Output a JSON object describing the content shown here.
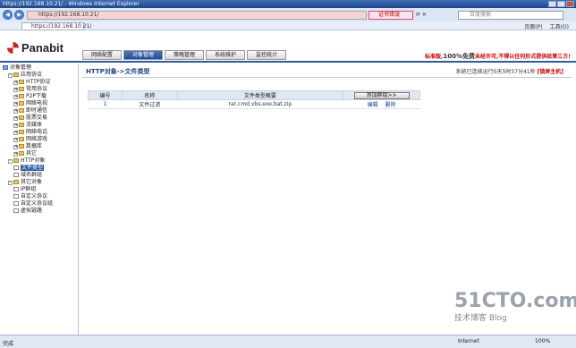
{
  "window": {
    "title": "https://192.168.10.21/ - Windows Internet Explorer"
  },
  "browser": {
    "address": "https://192.168.10.21/",
    "cert_error": "证书错误",
    "search_placeholder": "百度搜索",
    "tab_title": "https://192.168.10.21/",
    "tools": [
      "页面(P)",
      "工具(O)"
    ]
  },
  "app": {
    "logo": "Panabit",
    "nav": [
      "网络配置",
      "对象管理",
      "策略管理",
      "系统维护",
      "监控统计"
    ],
    "active_nav": 1,
    "promo_prefix": "标准版,",
    "promo_big": "100%免费",
    "promo_suffix": "未经许可,不得以任何形式提供给第三方!"
  },
  "sidebar": {
    "items": [
      {
        "label": "对象管理",
        "level": 0,
        "icon": "pc",
        "pm": ""
      },
      {
        "label": "应用协议",
        "level": 1,
        "icon": "folder",
        "pm": "-"
      },
      {
        "label": "HTTP协议",
        "level": 2,
        "icon": "folder",
        "pm": "+"
      },
      {
        "label": "常用协议",
        "level": 2,
        "icon": "folder",
        "pm": "+"
      },
      {
        "label": "P2P下载",
        "level": 2,
        "icon": "folder",
        "pm": "+"
      },
      {
        "label": "网络电视",
        "level": 2,
        "icon": "folder",
        "pm": "+"
      },
      {
        "label": "即时通信",
        "level": 2,
        "icon": "folder",
        "pm": "+"
      },
      {
        "label": "股票交易",
        "level": 2,
        "icon": "folder",
        "pm": "+"
      },
      {
        "label": "流媒体",
        "level": 2,
        "icon": "folder",
        "pm": "+"
      },
      {
        "label": "网络电话",
        "level": 2,
        "icon": "folder",
        "pm": "+"
      },
      {
        "label": "网络游戏",
        "level": 2,
        "icon": "folder",
        "pm": "+"
      },
      {
        "label": "数据库",
        "level": 2,
        "icon": "folder",
        "pm": "+"
      },
      {
        "label": "其它",
        "level": 2,
        "icon": "folder",
        "pm": "+"
      },
      {
        "label": "HTTP对象",
        "level": 1,
        "icon": "folder",
        "pm": "-"
      },
      {
        "label": "文件类型",
        "level": 2,
        "icon": "doc",
        "pm": "",
        "selected": true
      },
      {
        "label": "域名群组",
        "level": 2,
        "icon": "doc",
        "pm": ""
      },
      {
        "label": "其它对象",
        "level": 1,
        "icon": "folder",
        "pm": "-"
      },
      {
        "label": "IP群组",
        "level": 2,
        "icon": "doc",
        "pm": ""
      },
      {
        "label": "自定义协议",
        "level": 2,
        "icon": "doc",
        "pm": ""
      },
      {
        "label": "自定义协议组",
        "level": 2,
        "icon": "doc",
        "pm": ""
      },
      {
        "label": "虚拟链路",
        "level": 2,
        "icon": "doc",
        "pm": ""
      }
    ]
  },
  "main": {
    "breadcrumb": "HTTP对象->文件类型",
    "status_text": "系统已连续运行0天5时37分41秒",
    "status_lock": "[锁屏主机]",
    "table": {
      "headers": [
        "编号",
        "名称",
        "文件类型概要"
      ],
      "add_button": "添加群组>>",
      "rows": [
        {
          "id": "1",
          "name": "文件过滤",
          "summary": "rar,cmd,vbs,exe,bat,zip",
          "edit": "编辑",
          "delete": "删除"
        }
      ]
    }
  },
  "statusbar": {
    "left": "完成",
    "zone": "Internet",
    "zoom": "100%"
  },
  "watermark": {
    "line1": "51CTO.com",
    "line2": "技术博客  Blog"
  }
}
